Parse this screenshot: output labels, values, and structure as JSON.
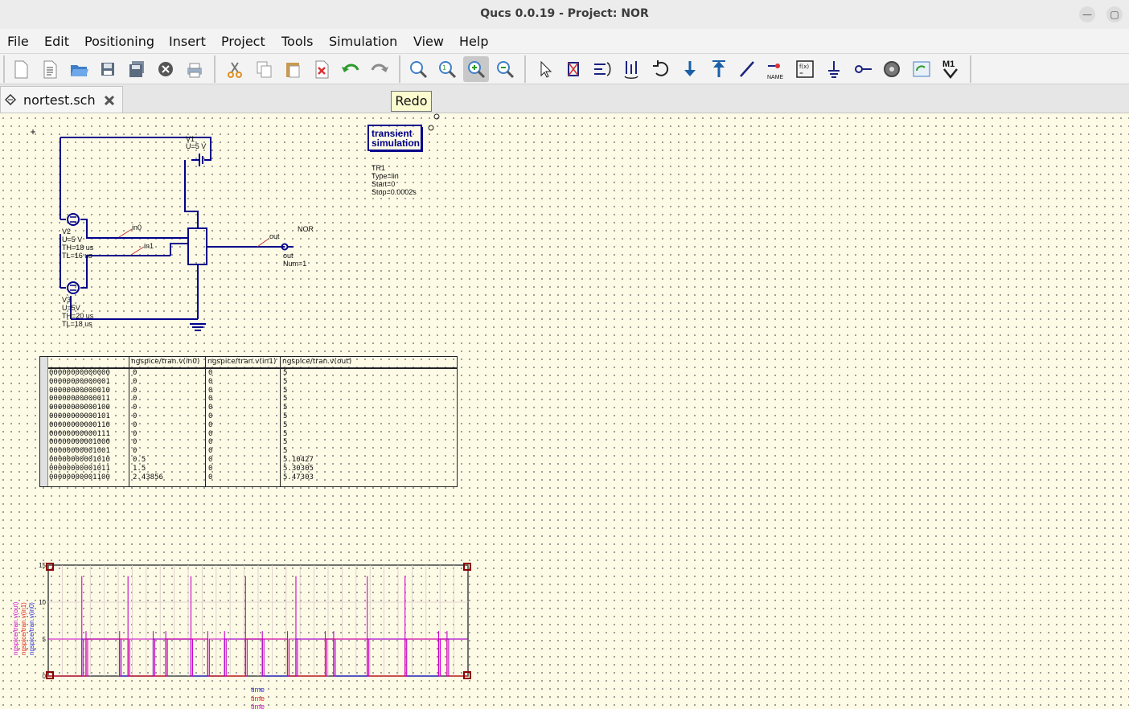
{
  "window": {
    "title": "Qucs 0.0.19 - Project: NOR"
  },
  "menu": [
    "File",
    "Edit",
    "Positioning",
    "Insert",
    "Project",
    "Tools",
    "Simulation",
    "View",
    "Help"
  ],
  "toolbar": {
    "icons": [
      "new-file-icon",
      "new-text-icon",
      "open-icon",
      "save-icon",
      "save-all-icon",
      "close-icon",
      "print-icon",
      "cut-icon",
      "copy-icon",
      "paste-icon",
      "delete-icon",
      "undo-icon",
      "redo-icon",
      "zoom-fit-icon",
      "zoom-1to1-icon",
      "zoom-in-icon",
      "zoom-out-icon",
      "select-icon",
      "deactivate-icon",
      "mirror-x-icon",
      "mirror-y-icon",
      "rotate-icon",
      "go-into-icon",
      "pop-out-icon",
      "wire-icon",
      "wire-label-icon",
      "equation-icon",
      "ground-icon",
      "port-icon",
      "simulate-icon",
      "view-data-icon",
      "marker-icon"
    ],
    "name_label": "NAME",
    "marker_label": "M1",
    "tooltip": "Redo"
  },
  "tab": {
    "filename": "nortest.sch"
  },
  "schematic": {
    "sim_box": {
      "line1": "transient",
      "line2": "simulation"
    },
    "sim_params": [
      "TR1",
      "Type=lin",
      "Start=0",
      "Stop=0.0002s"
    ],
    "v1": {
      "name": "V1",
      "value": "U=5 V"
    },
    "v2": [
      "V2",
      "U=5 V",
      "TH=18 us",
      "TL=16 us"
    ],
    "v3": [
      "V3",
      "U=5V",
      "TH=20 us",
      "TL=18 us"
    ],
    "labels": {
      "in0": "in0",
      "in1": "in1",
      "out_wire": "out",
      "gate": "NOR"
    },
    "port": [
      "out",
      "Num=1"
    ]
  },
  "table": {
    "headers": [
      "ngspice/tran.v(in0)",
      "ngspice/tran.v(in1)",
      "ngspice/tran.v(out)"
    ],
    "rows": [
      [
        "00000000000000",
        "0",
        "0",
        "5"
      ],
      [
        "00000000000001",
        "0",
        "0",
        "5"
      ],
      [
        "00000000000010",
        "0",
        "0",
        "5"
      ],
      [
        "00000000000011",
        "0",
        "0",
        "5"
      ],
      [
        "00000000000100",
        "0",
        "0",
        "5"
      ],
      [
        "00000000000101",
        "0",
        "0",
        "5"
      ],
      [
        "00000000000110",
        "0",
        "0",
        "5"
      ],
      [
        "00000000000111",
        "0",
        "0",
        "5"
      ],
      [
        "00000000001000",
        "0",
        "0",
        "5"
      ],
      [
        "00000000001001",
        "0",
        "0",
        "5"
      ],
      [
        "00000000001010",
        "0.5",
        "0",
        "5.10427"
      ],
      [
        "00000000001011",
        "1.5",
        "0",
        "5.30305"
      ],
      [
        "00000000001100",
        "2.43856",
        "0",
        "5.47303"
      ]
    ]
  },
  "plot": {
    "ylabels": [
      "ngspice/tran.v(out)",
      "ngspice/tran.v(in1)",
      "ngspice/tran.v(in0)"
    ],
    "xlabels": [
      "time",
      "time",
      "time"
    ],
    "series_colors": {
      "in0": "#2b2bd6",
      "in1": "#e02020",
      "out": "#cc00cc"
    }
  },
  "chart_data": {
    "type": "line",
    "title": "",
    "xlabel": "time",
    "ylabel": "",
    "xlim": [
      0,
      0.0002
    ],
    "ylim": [
      0,
      15
    ],
    "yticks": [
      0,
      5,
      10,
      15
    ],
    "grid": true,
    "series": [
      {
        "name": "ngspice/tran.v(in0)",
        "period_us": 34,
        "high_us": 18,
        "low_us": 16,
        "values": [
          0,
          5
        ]
      },
      {
        "name": "ngspice/tran.v(in1)",
        "period_us": 38,
        "high_us": 20,
        "low_us": 18,
        "values": [
          0,
          5
        ]
      },
      {
        "name": "ngspice/tran.v(out)",
        "values": [
          0,
          5,
          13.5
        ]
      }
    ]
  }
}
